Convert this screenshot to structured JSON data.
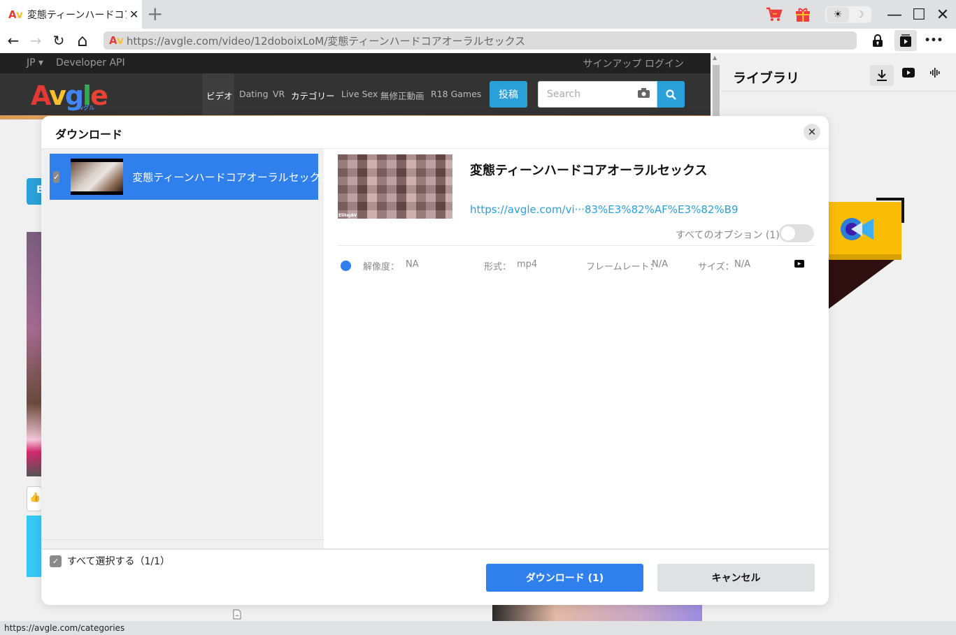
{
  "browser": {
    "tab_title": "変態ティーンハードコアオ",
    "url": "https://avgle.com/video/12doboixLoM/変態ティーンハードコアオーラルセックス",
    "favicon": "Av",
    "status_url": "https://avgle.com/categories",
    "icons": {
      "cart": "cart-icon",
      "gift": "gift-icon",
      "sun": "☀",
      "moon": "☽",
      "minimize": "—",
      "maximize": "☐",
      "close": "✕",
      "back": "←",
      "forward": "→",
      "reload": "↻",
      "home": "⌂",
      "lock": "lock-icon",
      "media": "media-icon",
      "more": "•••",
      "new_tab": "+"
    }
  },
  "site": {
    "lang": "JP ▾",
    "developer_api": "Developer API",
    "signup_login": "サインアップ  ログイン",
    "logo": {
      "a": "A",
      "v": "v",
      "g": "g",
      "l": "l",
      "e": "e",
      "sub": "Avグル"
    },
    "nav": [
      "ビデオ",
      "Dating",
      "VR",
      "カテゴリー",
      "Live Sex",
      "無修正動画",
      "R18 Games"
    ],
    "post_button": "投稿",
    "search_placeholder": "Search",
    "left_button_initial": "B"
  },
  "library": {
    "title": "ライブラリ",
    "tabs": [
      "download",
      "youtube",
      "audio"
    ]
  },
  "dialog": {
    "title": "ダウンロード",
    "close": "✕",
    "items": [
      {
        "title": "変態ティーンハードコアオーラルセックス",
        "checked": true
      }
    ],
    "select_all": "すべて選択する（1/1）",
    "detail": {
      "title": "変態ティーンハードコアオーラルセックス",
      "link": "https://avgle.com/vi···83%E3%82%AF%E3%82%B9",
      "all_options": "すべてのオプション (1)",
      "all_options_enabled": false,
      "thumb_watermark": "EliteJAV",
      "format": {
        "resolution_label": "解像度：",
        "resolution": "NA",
        "format_label": "形式：",
        "format": "mp4",
        "framerate_label": "フレームレート：",
        "framerate": "N/A",
        "size_label": "サイズ：",
        "size": "N/A"
      }
    },
    "download_button": "ダウンロード (1)",
    "cancel_button": "キャンセル"
  },
  "colors": {
    "accent": "#2f80ed",
    "site_blue": "#2a9fd8",
    "link": "#2a9fd8"
  }
}
